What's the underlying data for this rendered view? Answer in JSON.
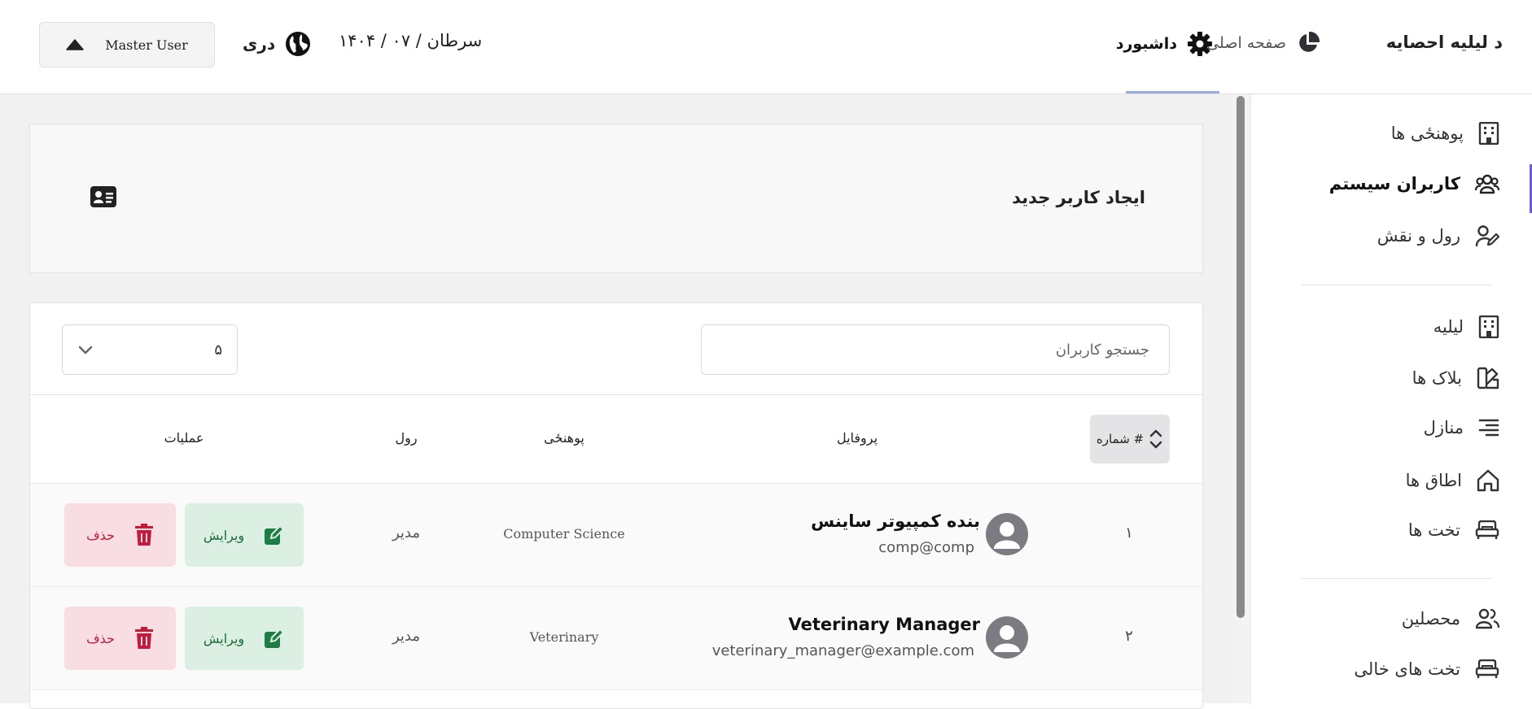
{
  "header": {
    "brand": "د لیلیه احصایه",
    "nav_home": "صفحه اصلی",
    "nav_dashboard": "داشبورد",
    "date": "۱۴۰۴ / سرطان / ۰۷",
    "language": "دری",
    "user": "Master User"
  },
  "sidebar": {
    "items": [
      {
        "label": "پوهنځی ها",
        "icon": "building-icon"
      },
      {
        "label": "کاربران سیستم",
        "icon": "users-icon",
        "active": true
      },
      {
        "label": "رول و نقش",
        "icon": "user-pen-icon"
      },
      {
        "label": "لیلیه",
        "icon": "building-icon"
      },
      {
        "label": "بلاک ها",
        "icon": "swatch-book-icon"
      },
      {
        "label": "منازل",
        "icon": "align-right-icon"
      },
      {
        "label": "اطاق ها",
        "icon": "home-icon"
      },
      {
        "label": "تخت ها",
        "icon": "bed-icon"
      },
      {
        "label": "محصلین",
        "icon": "users-icon"
      },
      {
        "label": "تخت های خالی",
        "icon": "bed-icon"
      }
    ]
  },
  "create_card": {
    "title": "ایجاد کاربر جدید",
    "icon": "id-card-icon"
  },
  "table": {
    "search_placeholder": "جستجو کاربران",
    "page_size": "۵",
    "headers": {
      "number": "شماره #",
      "profile": "پروفایل",
      "faculty": "پوهنځی",
      "role": "رول",
      "actions": "عملیات"
    },
    "rows": [
      {
        "num": "۱",
        "name": "بنده کمپیوتر ساینس",
        "email": "comp@comp",
        "faculty": "Computer Science",
        "role": "مدیر"
      },
      {
        "num": "۲",
        "name": "Veterinary Manager",
        "email": "veterinary_manager@example.com",
        "faculty": "Veterinary",
        "role": "مدیر"
      }
    ],
    "edit_label": "ویرایش",
    "delete_label": "حذف"
  },
  "colors": {
    "accent": "#6b5bd6",
    "edit_bg": "#dcefe3",
    "edit_fg": "#1b6b3a",
    "delete_bg": "#f8dee3",
    "delete_fg": "#c41a3b"
  }
}
